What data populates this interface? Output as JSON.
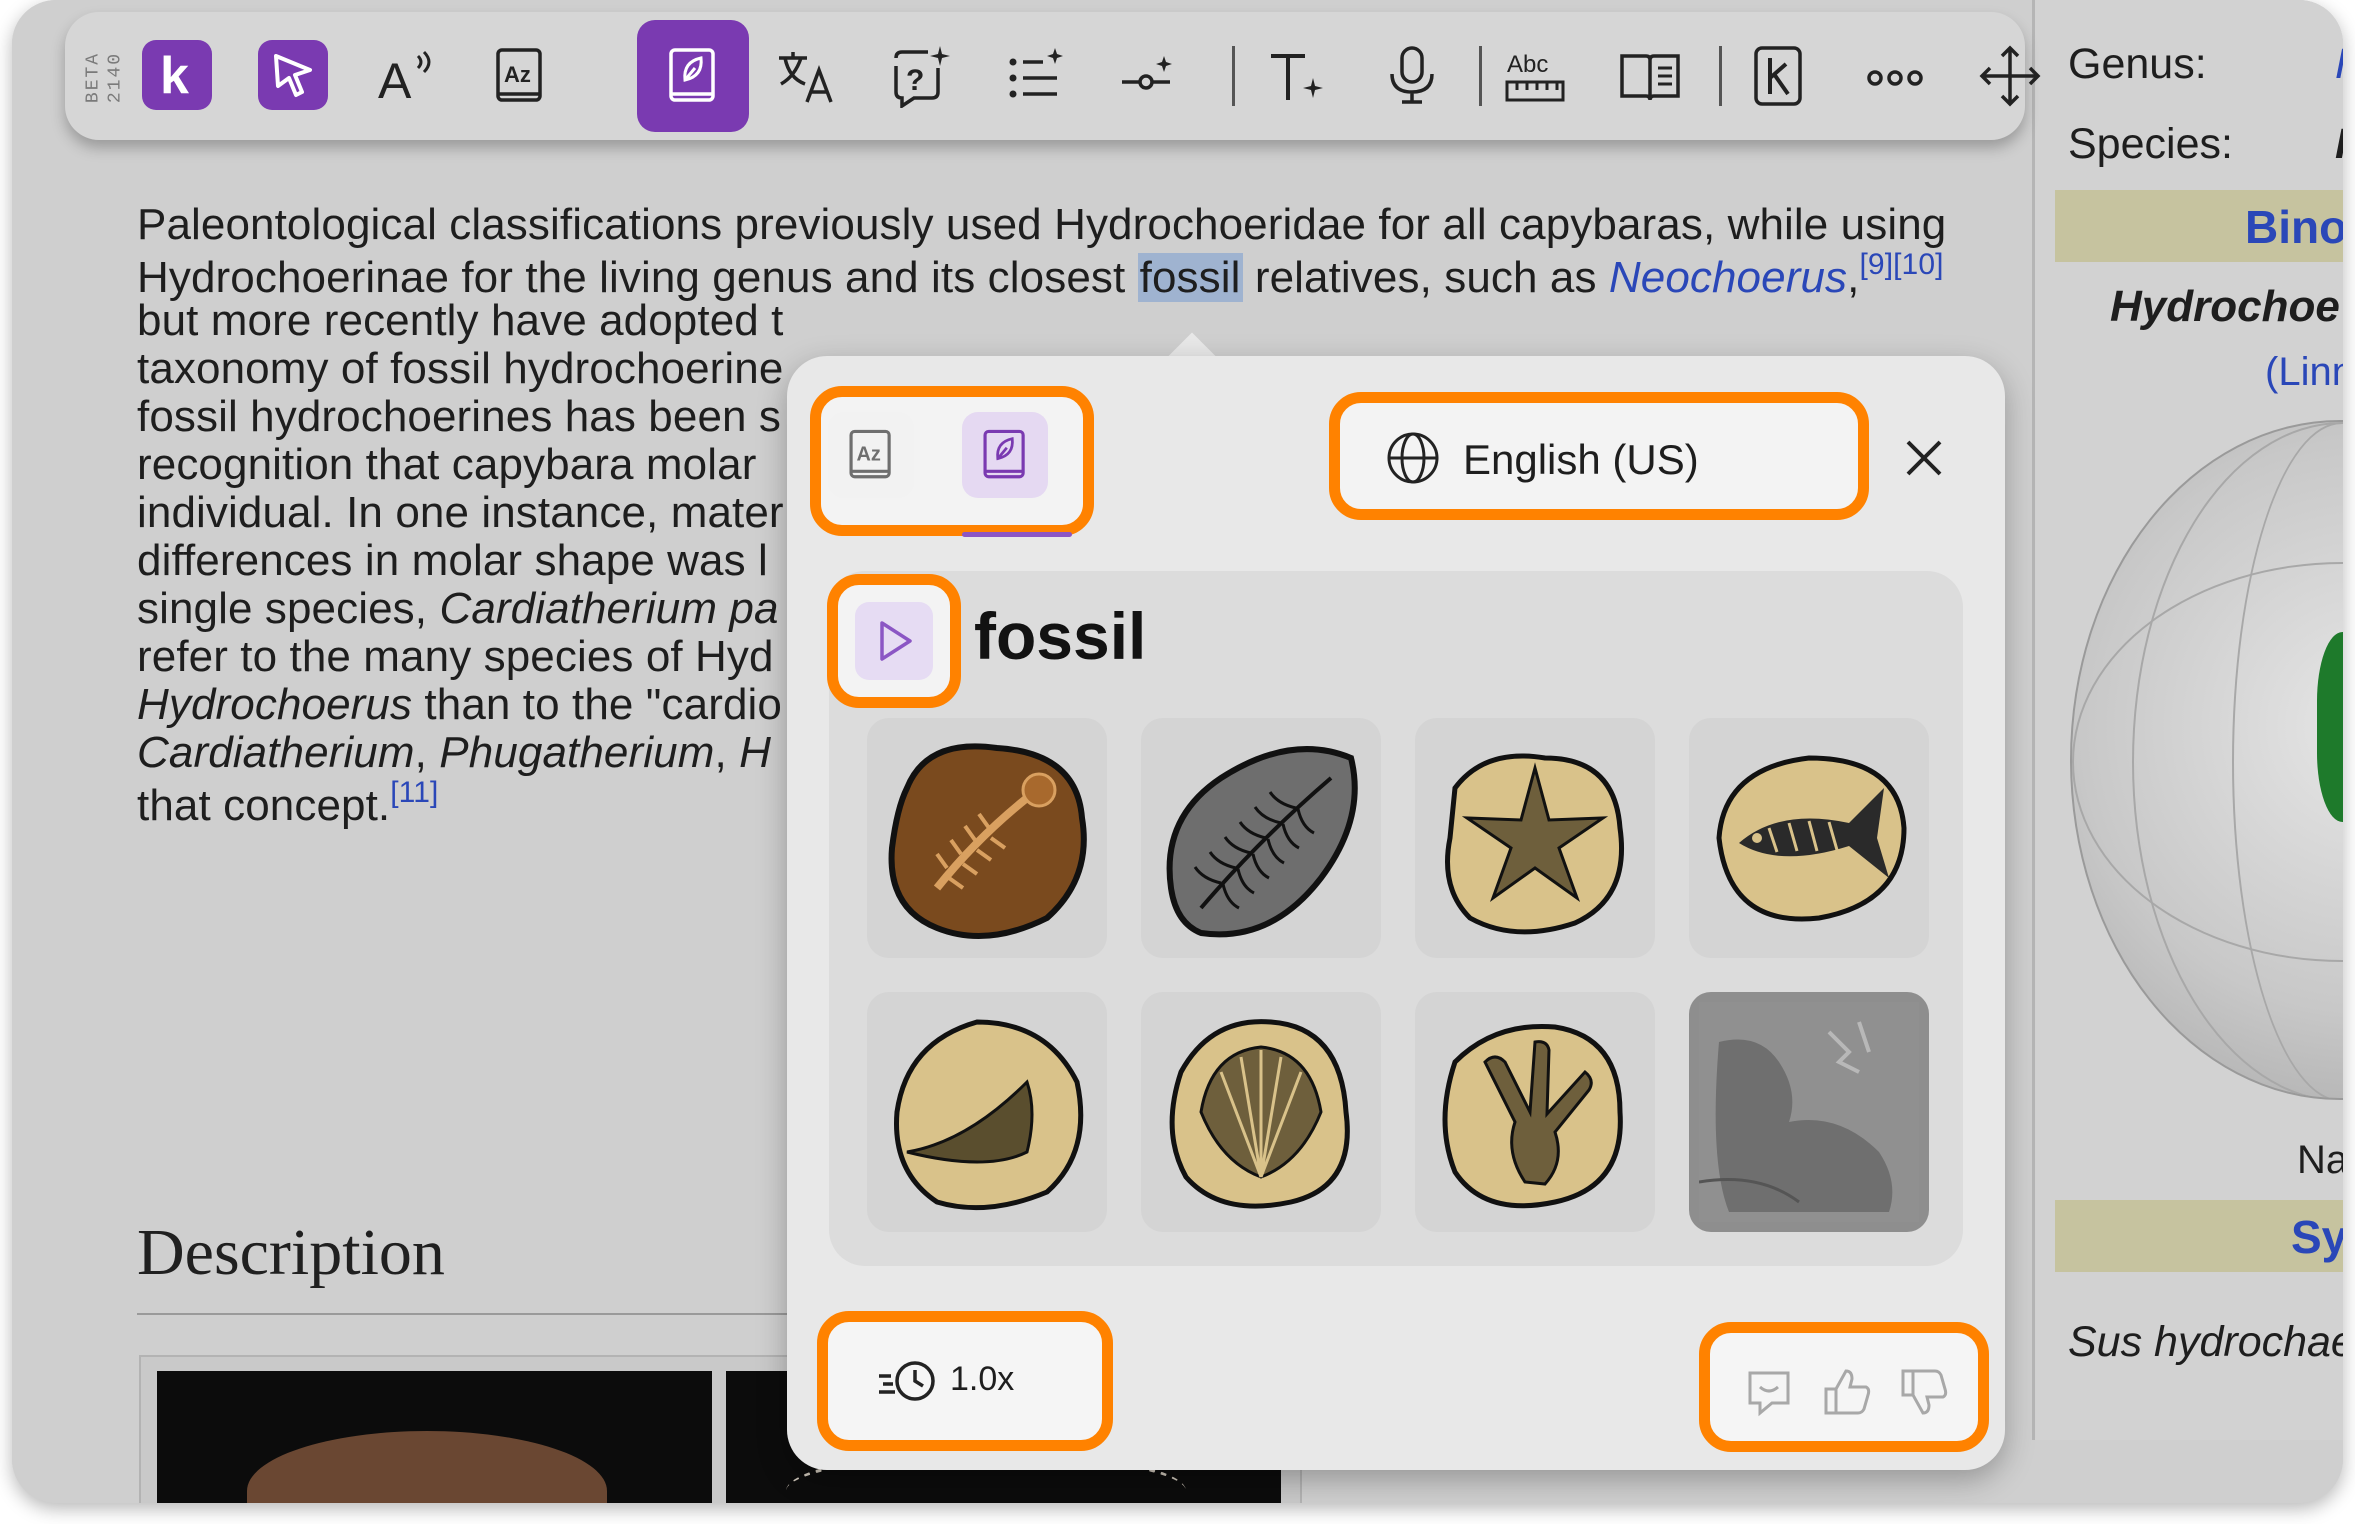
{
  "toolbar": {
    "beta_label": "BETA",
    "version": "2140",
    "buttons": [
      {
        "id": "logo",
        "icon": "k-logo-icon"
      },
      {
        "id": "select",
        "icon": "cursor-select-icon"
      },
      {
        "id": "read-aloud",
        "icon": "read-aloud-icon"
      },
      {
        "id": "dictionary",
        "icon": "dictionary-icon"
      },
      {
        "id": "picture-dictionary",
        "icon": "picture-dictionary-icon",
        "active": true
      },
      {
        "id": "translate",
        "icon": "translate-icon"
      },
      {
        "id": "ask",
        "icon": "question-sparkle-icon"
      },
      {
        "id": "summary",
        "icon": "list-sparkle-icon"
      },
      {
        "id": "dictate-tool",
        "icon": "node-sparkle-icon"
      },
      {
        "id": "text-style",
        "icon": "text-sparkle-icon"
      },
      {
        "id": "voice",
        "icon": "microphone-icon"
      },
      {
        "id": "spelling",
        "icon": "spelling-icon"
      },
      {
        "id": "reader",
        "icon": "book-reader-icon"
      },
      {
        "id": "kurzweil",
        "icon": "k-book-icon"
      },
      {
        "id": "more",
        "icon": "more-dots-icon"
      },
      {
        "id": "move",
        "icon": "move-arrows-icon"
      }
    ]
  },
  "article": {
    "lines": [
      {
        "segments": [
          {
            "t": "Paleontological classifications previously used Hydrochoeridae for all capybaras, while using"
          }
        ]
      },
      {
        "segments": [
          {
            "t": "Hydrochoerinae for the living genus and its closest "
          },
          {
            "t": "fossil",
            "hl": true
          },
          {
            "t": " relatives, such as "
          },
          {
            "t": "Neochoerus",
            "link": true,
            "i": true
          },
          {
            "t": ","
          },
          {
            "t": "[9][10]",
            "sup": true
          }
        ]
      },
      {
        "segments": [
          {
            "t": "but more recently have adopted t"
          }
        ]
      },
      {
        "segments": [
          {
            "t": "taxonomy of fossil hydrochoerine"
          }
        ]
      },
      {
        "segments": [
          {
            "t": "fossil hydrochoerines has been s"
          }
        ]
      },
      {
        "segments": [
          {
            "t": "recognition that capybara molar "
          }
        ]
      },
      {
        "segments": [
          {
            "t": "individual. In one instance, mater"
          }
        ]
      },
      {
        "segments": [
          {
            "t": "differences in molar shape was l"
          }
        ]
      },
      {
        "segments": [
          {
            "t": "single species, "
          },
          {
            "t": "Cardiatherium pa",
            "i": true
          }
        ]
      },
      {
        "segments": [
          {
            "t": "refer to the many species of Hyd"
          }
        ]
      },
      {
        "segments": [
          {
            "t": "Hydrochoerus",
            "i": true
          },
          {
            "t": " than to the \"cardio"
          }
        ]
      },
      {
        "segments": [
          {
            "t": "Cardiatherium",
            "i": true
          },
          {
            "t": ", "
          },
          {
            "t": "Phugatherium",
            "i": true
          },
          {
            "t": ", "
          },
          {
            "t": "H",
            "i": true
          }
        ]
      },
      {
        "segments": [
          {
            "t": "that concept."
          },
          {
            "t": "[11]",
            "sup": true
          }
        ]
      }
    ],
    "description_heading": "Description"
  },
  "infobox": {
    "genus_label": "Genus:",
    "genus_value": "H",
    "species_label": "Species:",
    "species_value": "H.",
    "binomial_band": "Bino",
    "binomial_name": "Hydrochoe",
    "authority": "(Linn",
    "map_caption": "Nat",
    "synonyms_band": "Sy",
    "synonym": "Sus hydrochae"
  },
  "popup": {
    "tabs": [
      {
        "id": "dictionary",
        "icon": "dictionary-icon",
        "selected": false
      },
      {
        "id": "picture-dictionary",
        "icon": "picture-dictionary-icon",
        "selected": true
      }
    ],
    "language": "English (US)",
    "language_icon": "globe-icon",
    "close_icon": "close-icon",
    "word": "fossil",
    "play_icon": "play-icon",
    "images": [
      {
        "name": "amphibian-fossil-image"
      },
      {
        "name": "fern-fossil-image"
      },
      {
        "name": "starfish-fossil-image"
      },
      {
        "name": "fish-fossil-image"
      },
      {
        "name": "tooth-fossil-image"
      },
      {
        "name": "shell-fossil-image"
      },
      {
        "name": "footprint-fossil-image"
      },
      {
        "name": "dinosaur-skeleton-fossil-image"
      }
    ],
    "speed": "1.0x",
    "speed_icon": "speech-rate-icon",
    "feedback_icons": [
      "comment-icon",
      "thumbs-up-icon",
      "thumbs-down-icon"
    ]
  },
  "colors": {
    "accent": "#7a3ab1",
    "highlight_outline": "#ff8200",
    "link": "#2a47b8"
  }
}
